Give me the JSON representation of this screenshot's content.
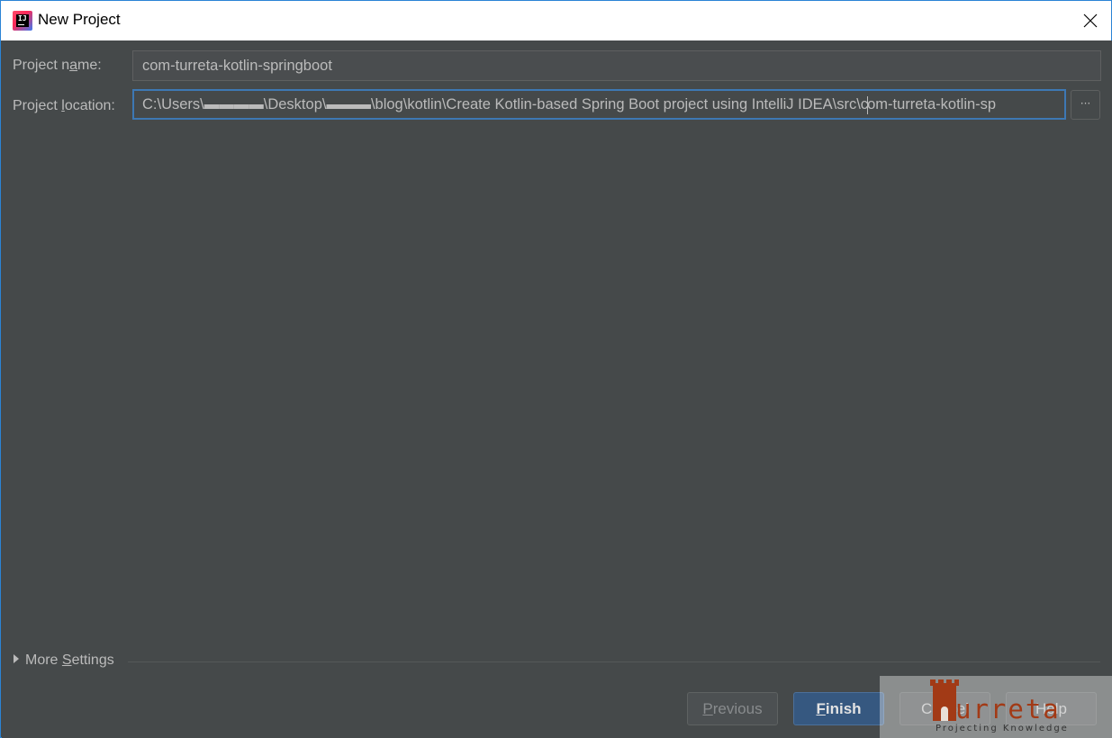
{
  "window": {
    "title": "New Project",
    "icon": "intellij-idea-icon"
  },
  "form": {
    "name_label_pre": "Project n",
    "name_label_mnemonic": "a",
    "name_label_post": "me:",
    "name_value": "com-turreta-kotlin-springboot",
    "location_label_pre": "Project ",
    "location_label_mnemonic": "l",
    "location_label_post": "ocation:",
    "location_value_before_caret": "C:\\Users\\▬▬▬▬\\Desktop\\▬▬▬\\blog\\kotlin\\Create Kotlin-based Spring Boot project using IntelliJ IDEA\\src\\c",
    "location_value_after_caret": "om-turreta-kotlin-sp",
    "browse_label": "···"
  },
  "more_settings": {
    "pre": "More ",
    "mnemonic": "S",
    "post": "ettings"
  },
  "buttons": {
    "previous_mnemonic": "P",
    "previous_rest": "revious",
    "finish_mnemonic": "F",
    "finish_rest": "inish",
    "cancel_label": "Cancel",
    "help_label": "Help"
  },
  "watermark": {
    "text": "urreta",
    "subtext": "Projecting Knowledge"
  },
  "colors": {
    "background": "#45494a",
    "text": "#bbbbbb",
    "focus_border": "#3d78b4",
    "finish_button": "#365880",
    "watermark": "#a23a16"
  }
}
